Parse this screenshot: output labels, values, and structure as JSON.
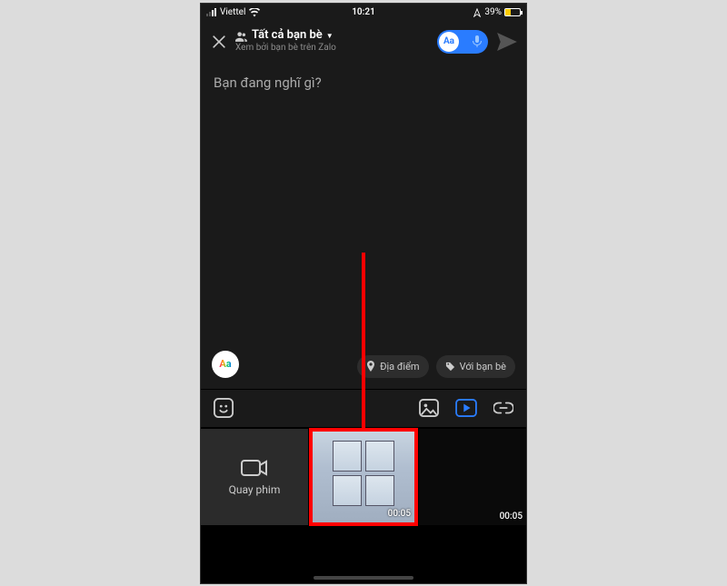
{
  "statusbar": {
    "carrier": "Viettel",
    "time": "10:21",
    "battery_pct": "39%"
  },
  "header": {
    "audience_title": "Tất cả bạn bè",
    "audience_sub": "Xem bởi bạn bè trên Zalo",
    "toggle_text": "Aa"
  },
  "composer": {
    "placeholder": "Bạn đang nghĩ gì?",
    "aa_label": "Aa",
    "location_chip": "Địa điểm",
    "friends_chip": "Với bạn bè"
  },
  "media": {
    "camera_label": "Quay phim",
    "thumb1_duration": "00:05",
    "thumb2_duration": "00:05"
  }
}
